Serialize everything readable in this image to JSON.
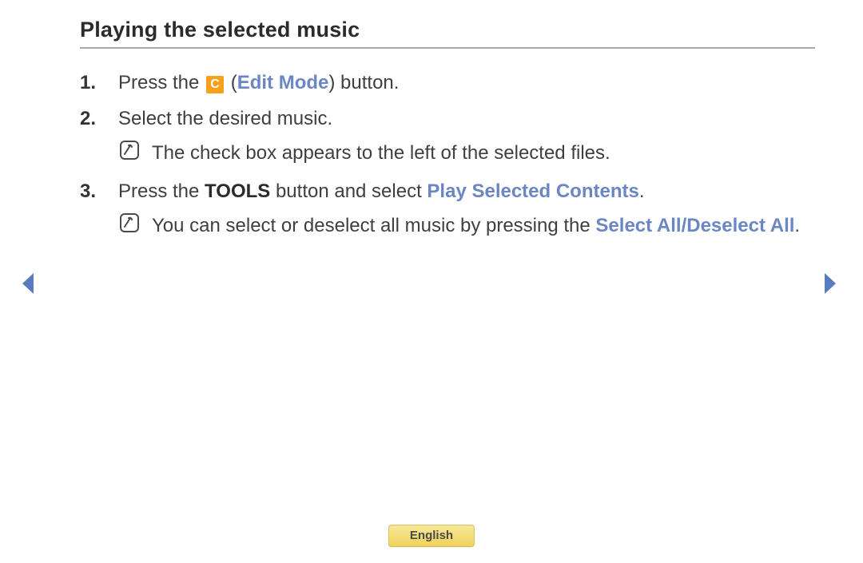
{
  "title": "Playing the selected music",
  "steps": {
    "s1": {
      "num": "1.",
      "pre": "Press the ",
      "badge": "C",
      "open_paren": " (",
      "mode": "Edit Mode",
      "post": ") button."
    },
    "s2": {
      "num": "2.",
      "text": "Select the desired music.",
      "note": "The check box appears to the left of the selected files."
    },
    "s3": {
      "num": "3.",
      "pre": "Press the ",
      "tools": "TOOLS",
      "mid": " button and select ",
      "play": "Play Selected Contents",
      "post": ".",
      "note_pre": "You can select or deselect all music by pressing the ",
      "note_hl": "Select All/Deselect All",
      "note_post": "."
    }
  },
  "footer": {
    "language": "English"
  }
}
